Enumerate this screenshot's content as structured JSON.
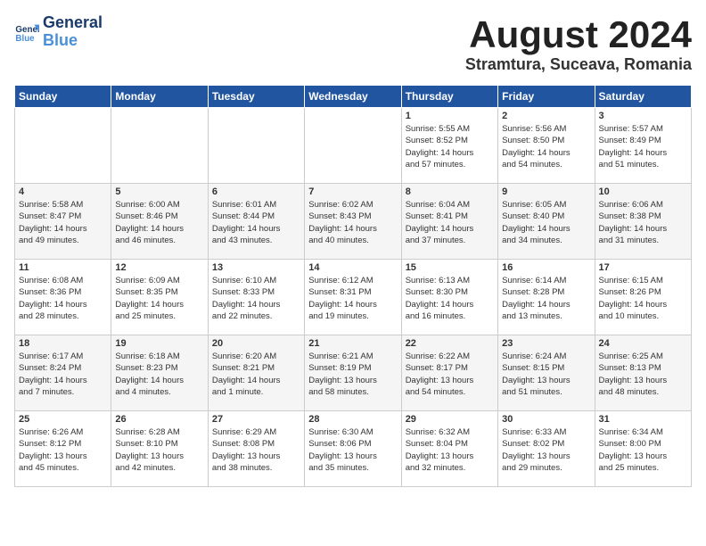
{
  "header": {
    "logo_line1": "General",
    "logo_line2": "Blue",
    "month_title": "August 2024",
    "location": "Stramtura, Suceava, Romania"
  },
  "days_of_week": [
    "Sunday",
    "Monday",
    "Tuesday",
    "Wednesday",
    "Thursday",
    "Friday",
    "Saturday"
  ],
  "weeks": [
    [
      {
        "day": "",
        "detail": ""
      },
      {
        "day": "",
        "detail": ""
      },
      {
        "day": "",
        "detail": ""
      },
      {
        "day": "",
        "detail": ""
      },
      {
        "day": "1",
        "detail": "Sunrise: 5:55 AM\nSunset: 8:52 PM\nDaylight: 14 hours\nand 57 minutes."
      },
      {
        "day": "2",
        "detail": "Sunrise: 5:56 AM\nSunset: 8:50 PM\nDaylight: 14 hours\nand 54 minutes."
      },
      {
        "day": "3",
        "detail": "Sunrise: 5:57 AM\nSunset: 8:49 PM\nDaylight: 14 hours\nand 51 minutes."
      }
    ],
    [
      {
        "day": "4",
        "detail": "Sunrise: 5:58 AM\nSunset: 8:47 PM\nDaylight: 14 hours\nand 49 minutes."
      },
      {
        "day": "5",
        "detail": "Sunrise: 6:00 AM\nSunset: 8:46 PM\nDaylight: 14 hours\nand 46 minutes."
      },
      {
        "day": "6",
        "detail": "Sunrise: 6:01 AM\nSunset: 8:44 PM\nDaylight: 14 hours\nand 43 minutes."
      },
      {
        "day": "7",
        "detail": "Sunrise: 6:02 AM\nSunset: 8:43 PM\nDaylight: 14 hours\nand 40 minutes."
      },
      {
        "day": "8",
        "detail": "Sunrise: 6:04 AM\nSunset: 8:41 PM\nDaylight: 14 hours\nand 37 minutes."
      },
      {
        "day": "9",
        "detail": "Sunrise: 6:05 AM\nSunset: 8:40 PM\nDaylight: 14 hours\nand 34 minutes."
      },
      {
        "day": "10",
        "detail": "Sunrise: 6:06 AM\nSunset: 8:38 PM\nDaylight: 14 hours\nand 31 minutes."
      }
    ],
    [
      {
        "day": "11",
        "detail": "Sunrise: 6:08 AM\nSunset: 8:36 PM\nDaylight: 14 hours\nand 28 minutes."
      },
      {
        "day": "12",
        "detail": "Sunrise: 6:09 AM\nSunset: 8:35 PM\nDaylight: 14 hours\nand 25 minutes."
      },
      {
        "day": "13",
        "detail": "Sunrise: 6:10 AM\nSunset: 8:33 PM\nDaylight: 14 hours\nand 22 minutes."
      },
      {
        "day": "14",
        "detail": "Sunrise: 6:12 AM\nSunset: 8:31 PM\nDaylight: 14 hours\nand 19 minutes."
      },
      {
        "day": "15",
        "detail": "Sunrise: 6:13 AM\nSunset: 8:30 PM\nDaylight: 14 hours\nand 16 minutes."
      },
      {
        "day": "16",
        "detail": "Sunrise: 6:14 AM\nSunset: 8:28 PM\nDaylight: 14 hours\nand 13 minutes."
      },
      {
        "day": "17",
        "detail": "Sunrise: 6:15 AM\nSunset: 8:26 PM\nDaylight: 14 hours\nand 10 minutes."
      }
    ],
    [
      {
        "day": "18",
        "detail": "Sunrise: 6:17 AM\nSunset: 8:24 PM\nDaylight: 14 hours\nand 7 minutes."
      },
      {
        "day": "19",
        "detail": "Sunrise: 6:18 AM\nSunset: 8:23 PM\nDaylight: 14 hours\nand 4 minutes."
      },
      {
        "day": "20",
        "detail": "Sunrise: 6:20 AM\nSunset: 8:21 PM\nDaylight: 14 hours\nand 1 minute."
      },
      {
        "day": "21",
        "detail": "Sunrise: 6:21 AM\nSunset: 8:19 PM\nDaylight: 13 hours\nand 58 minutes."
      },
      {
        "day": "22",
        "detail": "Sunrise: 6:22 AM\nSunset: 8:17 PM\nDaylight: 13 hours\nand 54 minutes."
      },
      {
        "day": "23",
        "detail": "Sunrise: 6:24 AM\nSunset: 8:15 PM\nDaylight: 13 hours\nand 51 minutes."
      },
      {
        "day": "24",
        "detail": "Sunrise: 6:25 AM\nSunset: 8:13 PM\nDaylight: 13 hours\nand 48 minutes."
      }
    ],
    [
      {
        "day": "25",
        "detail": "Sunrise: 6:26 AM\nSunset: 8:12 PM\nDaylight: 13 hours\nand 45 minutes."
      },
      {
        "day": "26",
        "detail": "Sunrise: 6:28 AM\nSunset: 8:10 PM\nDaylight: 13 hours\nand 42 minutes."
      },
      {
        "day": "27",
        "detail": "Sunrise: 6:29 AM\nSunset: 8:08 PM\nDaylight: 13 hours\nand 38 minutes."
      },
      {
        "day": "28",
        "detail": "Sunrise: 6:30 AM\nSunset: 8:06 PM\nDaylight: 13 hours\nand 35 minutes."
      },
      {
        "day": "29",
        "detail": "Sunrise: 6:32 AM\nSunset: 8:04 PM\nDaylight: 13 hours\nand 32 minutes."
      },
      {
        "day": "30",
        "detail": "Sunrise: 6:33 AM\nSunset: 8:02 PM\nDaylight: 13 hours\nand 29 minutes."
      },
      {
        "day": "31",
        "detail": "Sunrise: 6:34 AM\nSunset: 8:00 PM\nDaylight: 13 hours\nand 25 minutes."
      }
    ]
  ]
}
